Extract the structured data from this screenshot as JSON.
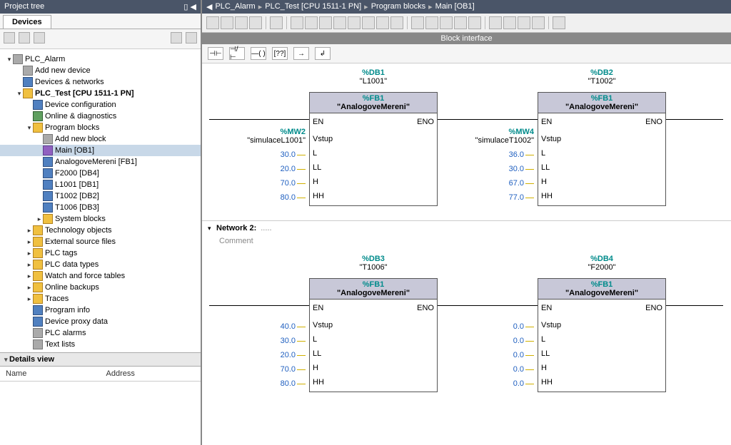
{
  "sidebar": {
    "title": "Project tree",
    "devices_tab": "Devices",
    "details_header": "Details view",
    "details_cols": {
      "name": "Name",
      "address": "Address"
    },
    "tree": [
      {
        "indent": 0,
        "arrow": "▾",
        "icon": "gray",
        "label": "PLC_Alarm"
      },
      {
        "indent": 1,
        "arrow": "",
        "icon": "gray",
        "label": "Add new device"
      },
      {
        "indent": 1,
        "arrow": "",
        "icon": "blue",
        "label": "Devices & networks"
      },
      {
        "indent": 1,
        "arrow": "▾",
        "icon": "",
        "label": "PLC_Test [CPU 1511-1 PN]",
        "bold": true
      },
      {
        "indent": 2,
        "arrow": "",
        "icon": "blue",
        "label": "Device configuration"
      },
      {
        "indent": 2,
        "arrow": "",
        "icon": "green",
        "label": "Online & diagnostics"
      },
      {
        "indent": 2,
        "arrow": "▾",
        "icon": "",
        "label": "Program blocks"
      },
      {
        "indent": 3,
        "arrow": "",
        "icon": "gray",
        "label": "Add new block"
      },
      {
        "indent": 3,
        "arrow": "",
        "icon": "purple",
        "label": "Main [OB1]",
        "selected": true
      },
      {
        "indent": 3,
        "arrow": "",
        "icon": "blue",
        "label": "AnalogoveMereni [FB1]"
      },
      {
        "indent": 3,
        "arrow": "",
        "icon": "blue",
        "label": "F2000 [DB4]"
      },
      {
        "indent": 3,
        "arrow": "",
        "icon": "blue",
        "label": "L1001 [DB1]"
      },
      {
        "indent": 3,
        "arrow": "",
        "icon": "blue",
        "label": "T1002 [DB2]"
      },
      {
        "indent": 3,
        "arrow": "",
        "icon": "blue",
        "label": "T1006 [DB3]"
      },
      {
        "indent": 3,
        "arrow": "▸",
        "icon": "",
        "label": "System blocks"
      },
      {
        "indent": 2,
        "arrow": "▸",
        "icon": "",
        "label": "Technology objects"
      },
      {
        "indent": 2,
        "arrow": "▸",
        "icon": "",
        "label": "External source files"
      },
      {
        "indent": 2,
        "arrow": "▸",
        "icon": "",
        "label": "PLC tags"
      },
      {
        "indent": 2,
        "arrow": "▸",
        "icon": "",
        "label": "PLC data types"
      },
      {
        "indent": 2,
        "arrow": "▸",
        "icon": "",
        "label": "Watch and force tables"
      },
      {
        "indent": 2,
        "arrow": "▸",
        "icon": "",
        "label": "Online backups"
      },
      {
        "indent": 2,
        "arrow": "▸",
        "icon": "",
        "label": "Traces"
      },
      {
        "indent": 2,
        "arrow": "",
        "icon": "blue",
        "label": "Program info"
      },
      {
        "indent": 2,
        "arrow": "",
        "icon": "blue",
        "label": "Device proxy data"
      },
      {
        "indent": 2,
        "arrow": "",
        "icon": "gray",
        "label": "PLC alarms"
      },
      {
        "indent": 2,
        "arrow": "",
        "icon": "gray",
        "label": "Text lists"
      }
    ]
  },
  "breadcrumb": [
    "PLC_Alarm",
    "PLC_Test [CPU 1511-1 PN]",
    "Program blocks",
    "Main [OB1]"
  ],
  "block_interface": "Block interface",
  "lad_buttons": [
    "⊣⊢",
    "⊣/⊢",
    "—( )",
    "[??]",
    "→",
    "↲"
  ],
  "pins": {
    "en": "EN",
    "eno": "ENO",
    "vstup": "Vstup",
    "l": "L",
    "ll": "LL",
    "h": "H",
    "hh": "HH"
  },
  "network1": {
    "blocks": [
      {
        "db_id": "%DB1",
        "db_name": "\"L1001\"",
        "fb_id": "%FB1",
        "fb_name": "\"AnalogoveMereni\"",
        "input_tag_id": "%MW2",
        "input_tag_name": "\"simulaceL1001\"",
        "vals": {
          "l": "30.0",
          "ll": "20.0",
          "h": "70.0",
          "hh": "80.0"
        }
      },
      {
        "db_id": "%DB2",
        "db_name": "\"T1002\"",
        "fb_id": "%FB1",
        "fb_name": "\"AnalogoveMereni\"",
        "input_tag_id": "%MW4",
        "input_tag_name": "\"simulaceT1002\"",
        "vals": {
          "l": "36.0",
          "ll": "30.0",
          "h": "67.0",
          "hh": "77.0"
        }
      }
    ]
  },
  "network2": {
    "header": "Network 2:",
    "dots": ".....",
    "comment": "Comment",
    "blocks": [
      {
        "db_id": "%DB3",
        "db_name": "\"T1006\"",
        "fb_id": "%FB1",
        "fb_name": "\"AnalogoveMereni\"",
        "vals": {
          "vstup": "40.0",
          "l": "30.0",
          "ll": "20.0",
          "h": "70.0",
          "hh": "80.0"
        }
      },
      {
        "db_id": "%DB4",
        "db_name": "\"F2000\"",
        "fb_id": "%FB1",
        "fb_name": "\"AnalogoveMereni\"",
        "vals": {
          "vstup": "0.0",
          "l": "0.0",
          "ll": "0.0",
          "h": "0.0",
          "hh": "0.0"
        }
      }
    ]
  }
}
